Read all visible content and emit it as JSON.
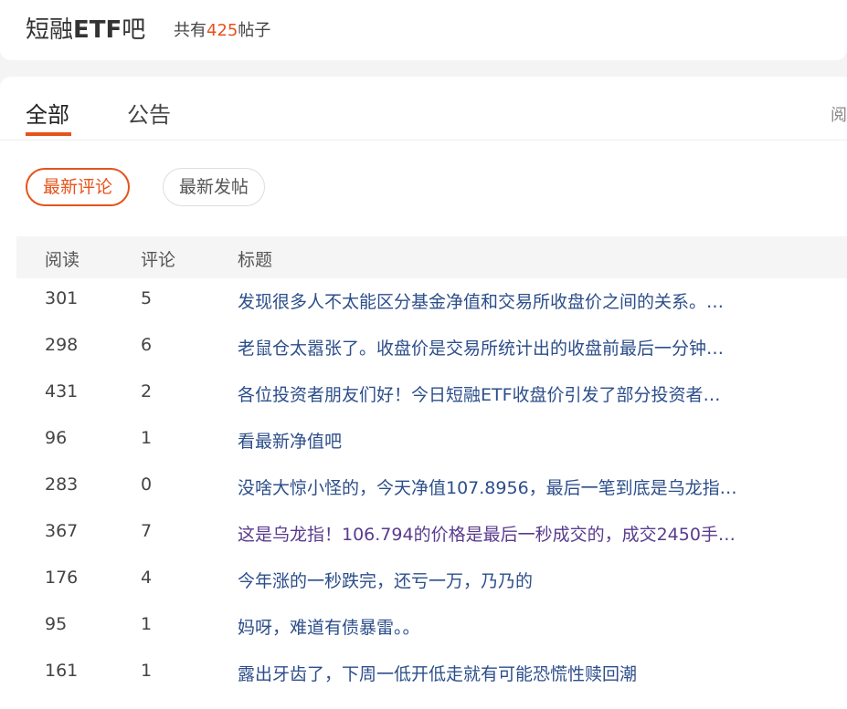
{
  "header": {
    "forum_name_prefix": "短融",
    "forum_name_bold": "ETF",
    "forum_name_suffix": "吧",
    "count_prefix": "共有",
    "count_value": "425",
    "count_suffix": "帖子"
  },
  "tabs": {
    "all_label": "全部",
    "notice_label": "公告",
    "right_fragment": "阅"
  },
  "sort": {
    "latest_comment_label": "最新评论",
    "latest_post_label": "最新发帖"
  },
  "table": {
    "columns": {
      "read": "阅读",
      "comment": "评论",
      "title": "标题"
    },
    "rows": [
      {
        "read": "301",
        "comment": "5",
        "title": "发现很多人不太能区分基金净值和交易所收盘价之间的关系。…",
        "visited": false
      },
      {
        "read": "298",
        "comment": "6",
        "title": "老鼠仓太嚣张了。收盘价是交易所统计出的收盘前最后一分钟…",
        "visited": false
      },
      {
        "read": "431",
        "comment": "2",
        "title": "各位投资者朋友们好！今日短融ETF收盘价引发了部分投资者…",
        "visited": false
      },
      {
        "read": "96",
        "comment": "1",
        "title": "看最新净值吧",
        "visited": false
      },
      {
        "read": "283",
        "comment": "0",
        "title": "没啥大惊小怪的，今天净值107.8956，最后一笔到底是乌龙指…",
        "visited": false
      },
      {
        "read": "367",
        "comment": "7",
        "title": "这是乌龙指！106.794的价格是最后一秒成交的，成交2450手…",
        "visited": true
      },
      {
        "read": "176",
        "comment": "4",
        "title": "今年涨的一秒跌完，还亏一万，乃乃的",
        "visited": false
      },
      {
        "read": "95",
        "comment": "1",
        "title": "妈呀，难道有债暴雷。。",
        "visited": false
      },
      {
        "read": "161",
        "comment": "1",
        "title": "露出牙齿了，下周一低开低走就有可能恐慌性赎回潮",
        "visited": false
      }
    ]
  },
  "colors": {
    "accent": "#e6531b",
    "link": "#2c4e8a",
    "visited_link": "#5a3a8e"
  }
}
